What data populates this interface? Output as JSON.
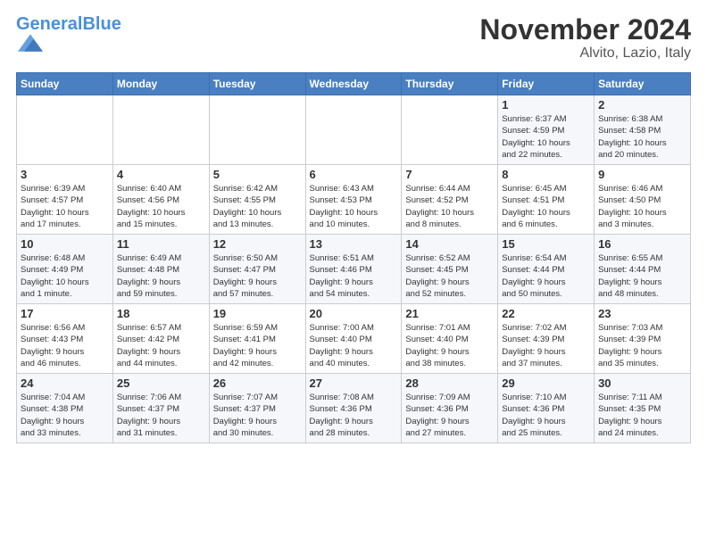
{
  "header": {
    "logo_general": "General",
    "logo_blue": "Blue",
    "month_title": "November 2024",
    "subtitle": "Alvito, Lazio, Italy"
  },
  "days_of_week": [
    "Sunday",
    "Monday",
    "Tuesday",
    "Wednesday",
    "Thursday",
    "Friday",
    "Saturday"
  ],
  "weeks": [
    [
      {
        "day": "",
        "info": ""
      },
      {
        "day": "",
        "info": ""
      },
      {
        "day": "",
        "info": ""
      },
      {
        "day": "",
        "info": ""
      },
      {
        "day": "",
        "info": ""
      },
      {
        "day": "1",
        "info": "Sunrise: 6:37 AM\nSunset: 4:59 PM\nDaylight: 10 hours\nand 22 minutes."
      },
      {
        "day": "2",
        "info": "Sunrise: 6:38 AM\nSunset: 4:58 PM\nDaylight: 10 hours\nand 20 minutes."
      }
    ],
    [
      {
        "day": "3",
        "info": "Sunrise: 6:39 AM\nSunset: 4:57 PM\nDaylight: 10 hours\nand 17 minutes."
      },
      {
        "day": "4",
        "info": "Sunrise: 6:40 AM\nSunset: 4:56 PM\nDaylight: 10 hours\nand 15 minutes."
      },
      {
        "day": "5",
        "info": "Sunrise: 6:42 AM\nSunset: 4:55 PM\nDaylight: 10 hours\nand 13 minutes."
      },
      {
        "day": "6",
        "info": "Sunrise: 6:43 AM\nSunset: 4:53 PM\nDaylight: 10 hours\nand 10 minutes."
      },
      {
        "day": "7",
        "info": "Sunrise: 6:44 AM\nSunset: 4:52 PM\nDaylight: 10 hours\nand 8 minutes."
      },
      {
        "day": "8",
        "info": "Sunrise: 6:45 AM\nSunset: 4:51 PM\nDaylight: 10 hours\nand 6 minutes."
      },
      {
        "day": "9",
        "info": "Sunrise: 6:46 AM\nSunset: 4:50 PM\nDaylight: 10 hours\nand 3 minutes."
      }
    ],
    [
      {
        "day": "10",
        "info": "Sunrise: 6:48 AM\nSunset: 4:49 PM\nDaylight: 10 hours\nand 1 minute."
      },
      {
        "day": "11",
        "info": "Sunrise: 6:49 AM\nSunset: 4:48 PM\nDaylight: 9 hours\nand 59 minutes."
      },
      {
        "day": "12",
        "info": "Sunrise: 6:50 AM\nSunset: 4:47 PM\nDaylight: 9 hours\nand 57 minutes."
      },
      {
        "day": "13",
        "info": "Sunrise: 6:51 AM\nSunset: 4:46 PM\nDaylight: 9 hours\nand 54 minutes."
      },
      {
        "day": "14",
        "info": "Sunrise: 6:52 AM\nSunset: 4:45 PM\nDaylight: 9 hours\nand 52 minutes."
      },
      {
        "day": "15",
        "info": "Sunrise: 6:54 AM\nSunset: 4:44 PM\nDaylight: 9 hours\nand 50 minutes."
      },
      {
        "day": "16",
        "info": "Sunrise: 6:55 AM\nSunset: 4:44 PM\nDaylight: 9 hours\nand 48 minutes."
      }
    ],
    [
      {
        "day": "17",
        "info": "Sunrise: 6:56 AM\nSunset: 4:43 PM\nDaylight: 9 hours\nand 46 minutes."
      },
      {
        "day": "18",
        "info": "Sunrise: 6:57 AM\nSunset: 4:42 PM\nDaylight: 9 hours\nand 44 minutes."
      },
      {
        "day": "19",
        "info": "Sunrise: 6:59 AM\nSunset: 4:41 PM\nDaylight: 9 hours\nand 42 minutes."
      },
      {
        "day": "20",
        "info": "Sunrise: 7:00 AM\nSunset: 4:40 PM\nDaylight: 9 hours\nand 40 minutes."
      },
      {
        "day": "21",
        "info": "Sunrise: 7:01 AM\nSunset: 4:40 PM\nDaylight: 9 hours\nand 38 minutes."
      },
      {
        "day": "22",
        "info": "Sunrise: 7:02 AM\nSunset: 4:39 PM\nDaylight: 9 hours\nand 37 minutes."
      },
      {
        "day": "23",
        "info": "Sunrise: 7:03 AM\nSunset: 4:39 PM\nDaylight: 9 hours\nand 35 minutes."
      }
    ],
    [
      {
        "day": "24",
        "info": "Sunrise: 7:04 AM\nSunset: 4:38 PM\nDaylight: 9 hours\nand 33 minutes."
      },
      {
        "day": "25",
        "info": "Sunrise: 7:06 AM\nSunset: 4:37 PM\nDaylight: 9 hours\nand 31 minutes."
      },
      {
        "day": "26",
        "info": "Sunrise: 7:07 AM\nSunset: 4:37 PM\nDaylight: 9 hours\nand 30 minutes."
      },
      {
        "day": "27",
        "info": "Sunrise: 7:08 AM\nSunset: 4:36 PM\nDaylight: 9 hours\nand 28 minutes."
      },
      {
        "day": "28",
        "info": "Sunrise: 7:09 AM\nSunset: 4:36 PM\nDaylight: 9 hours\nand 27 minutes."
      },
      {
        "day": "29",
        "info": "Sunrise: 7:10 AM\nSunset: 4:36 PM\nDaylight: 9 hours\nand 25 minutes."
      },
      {
        "day": "30",
        "info": "Sunrise: 7:11 AM\nSunset: 4:35 PM\nDaylight: 9 hours\nand 24 minutes."
      }
    ]
  ]
}
